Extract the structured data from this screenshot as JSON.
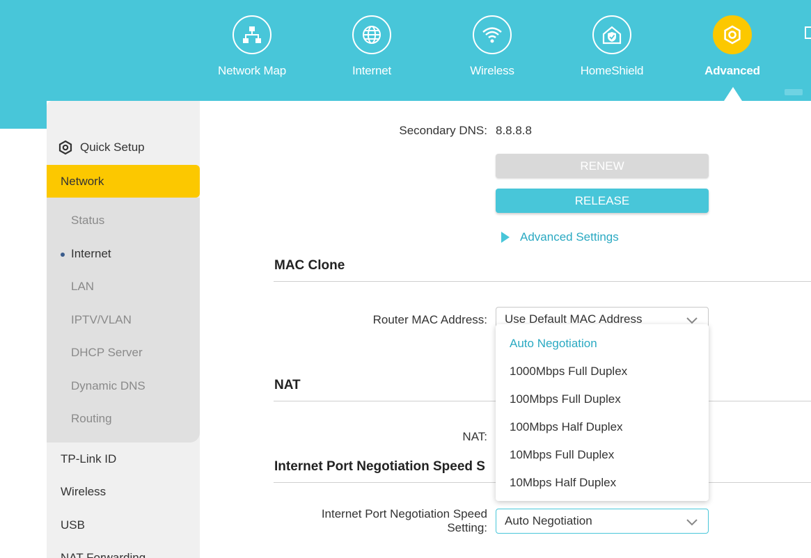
{
  "nav": {
    "items": [
      {
        "label": "Network Map",
        "icon": "network-map-icon"
      },
      {
        "label": "Internet",
        "icon": "globe-icon"
      },
      {
        "label": "Wireless",
        "icon": "wifi-icon"
      },
      {
        "label": "HomeShield",
        "icon": "home-shield-icon"
      },
      {
        "label": "Advanced",
        "icon": "gear-icon",
        "active": true
      }
    ]
  },
  "sidebar": {
    "quick_setup": "Quick Setup",
    "network": "Network",
    "sub_items": [
      "Status",
      "Internet",
      "LAN",
      "IPTV/VLAN",
      "DHCP Server",
      "Dynamic DNS",
      "Routing"
    ],
    "active_sub": "Internet",
    "items": [
      "TP-Link ID",
      "Wireless",
      "USB",
      "NAT Forwarding"
    ]
  },
  "content": {
    "secondary_dns_label": "Secondary DNS:",
    "secondary_dns_value": "8.8.8.8",
    "renew_label": "RENEW",
    "release_label": "RELEASE",
    "advanced_settings_label": "Advanced Settings",
    "mac_clone_title": "MAC Clone",
    "router_mac_label": "Router MAC Address:",
    "router_mac_value": "Use Default MAC Address",
    "nat_title": "NAT",
    "nat_label": "NAT:",
    "port_speed_title": "Internet Port Negotiation Speed S",
    "port_speed_label_line1": "Internet Port Negotiation Speed",
    "port_speed_label_line2": "Setting:",
    "port_speed_value": "Auto Negotiation"
  },
  "dropdown": {
    "options": [
      "Auto Negotiation",
      "1000Mbps Full Duplex",
      "100Mbps Full Duplex",
      "100Mbps Half Duplex",
      "10Mbps Full Duplex",
      "10Mbps Half Duplex"
    ],
    "selected": "Auto Negotiation"
  },
  "colors": {
    "brand": "#48c6d9",
    "accent": "#fcc800",
    "link": "#2aa9c2"
  }
}
